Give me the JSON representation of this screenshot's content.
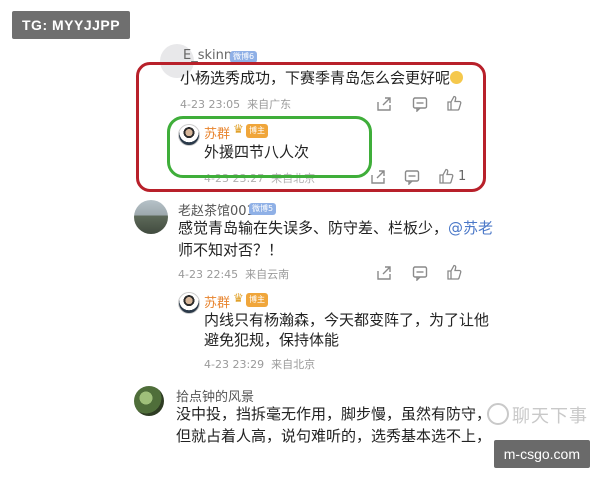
{
  "tag_badge": "TG: MYYJJPP",
  "site_badge": "m-csgo.com",
  "watermark": "聊天下事",
  "colors": {
    "red_box": "#b8202a",
    "green_box": "#3fae3a",
    "mention": "#4b78c8",
    "name_orange": "#e8842e"
  },
  "comments": [
    {
      "username": "E_skinny",
      "badge": "微博6",
      "text": "小杨选秀成功，下赛季青岛怎么会更好呢",
      "time": "4-23 23:05",
      "location": "来自广东",
      "reply": {
        "username": "苏群",
        "badge": "博主",
        "text": "外援四节八人次",
        "time": "4-23 23:27",
        "location": "来自北京",
        "likes": "1"
      }
    },
    {
      "username": "老赵茶馆001",
      "badge": "微博5",
      "text_line1": "感觉青岛输在失误多、防守差、栏板少，",
      "mention": "@苏老",
      "text_line2": "师不知对否？！",
      "time": "4-23 22:45",
      "location": "来自云南",
      "reply": {
        "username": "苏群",
        "badge": "博主",
        "text_line1": "内线只有杨瀚森，今天都变阵了，为了让他",
        "text_line2": "避免犯规，保持体能",
        "time": "4-23 23:29",
        "location": "来自北京"
      }
    },
    {
      "username": "拾点钟的风景",
      "text_line1": "没中投，挡拆毫无作用，脚步慢，虽然有防守，",
      "text_line2": "但就占着人高，说句难听的，选秀基本选不上，"
    }
  ],
  "icons": [
    "share-icon",
    "comment-icon",
    "like-icon",
    "crown-icon"
  ]
}
